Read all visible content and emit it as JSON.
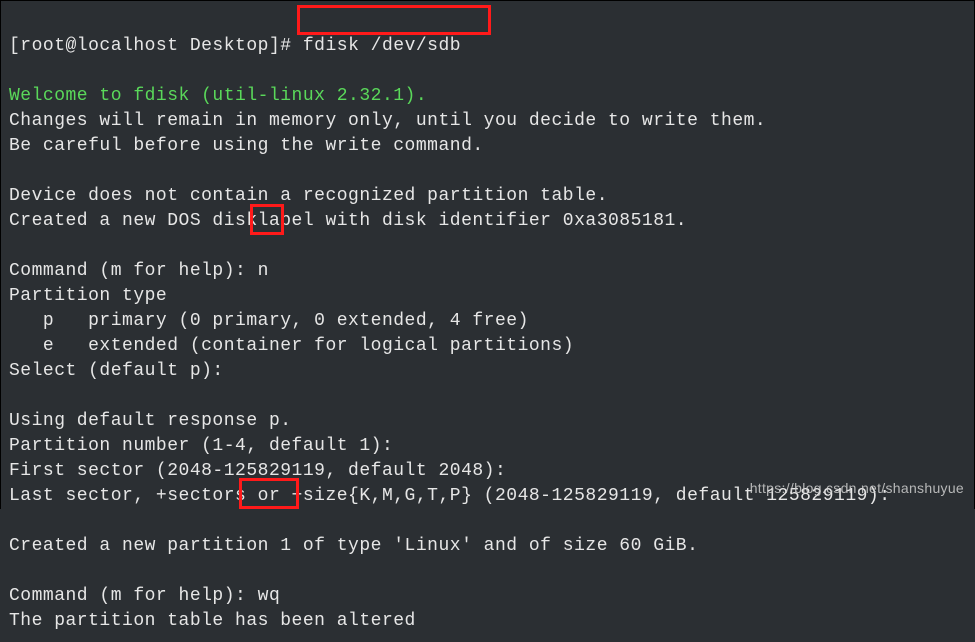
{
  "prompt": {
    "text": "[root@localhost Desktop]# ",
    "cmd": "fdisk /dev/sdb"
  },
  "lines": {
    "welcome": "Welcome to fdisk (util-linux 2.32.1).",
    "l1": "Changes will remain in memory only, until you decide to write them.",
    "l2": "Be careful before using the write command.",
    "blank": "",
    "l3": "Device does not contain a recognized partition table.",
    "l4": "Created a new DOS disklabel with disk identifier 0xa3085181.",
    "cmd_prompt1": "Command (m for help): ",
    "input_n": "n",
    "pt_head": "Partition type",
    "pt_p": "   p   primary (0 primary, 0 extended, 4 free)",
    "pt_e": "   e   extended (container for logical partitions)",
    "select": "Select (default p):",
    "resp": "Using default response p.",
    "num": "Partition number (1-4, default 1):",
    "first": "First sector (2048-125829119, default 2048):",
    "last": "Last sector, +sectors or +size{K,M,G,T,P} (2048-125829119, default 125829119):",
    "created": "Created a new partition 1 of type 'Linux' and of size 60 GiB.",
    "cmd_prompt2": "Command (m for help): ",
    "input_wq": "wq",
    "altered": "The partition table has been altered"
  },
  "watermark": "https://blog.csdn.net/shanshuyue"
}
